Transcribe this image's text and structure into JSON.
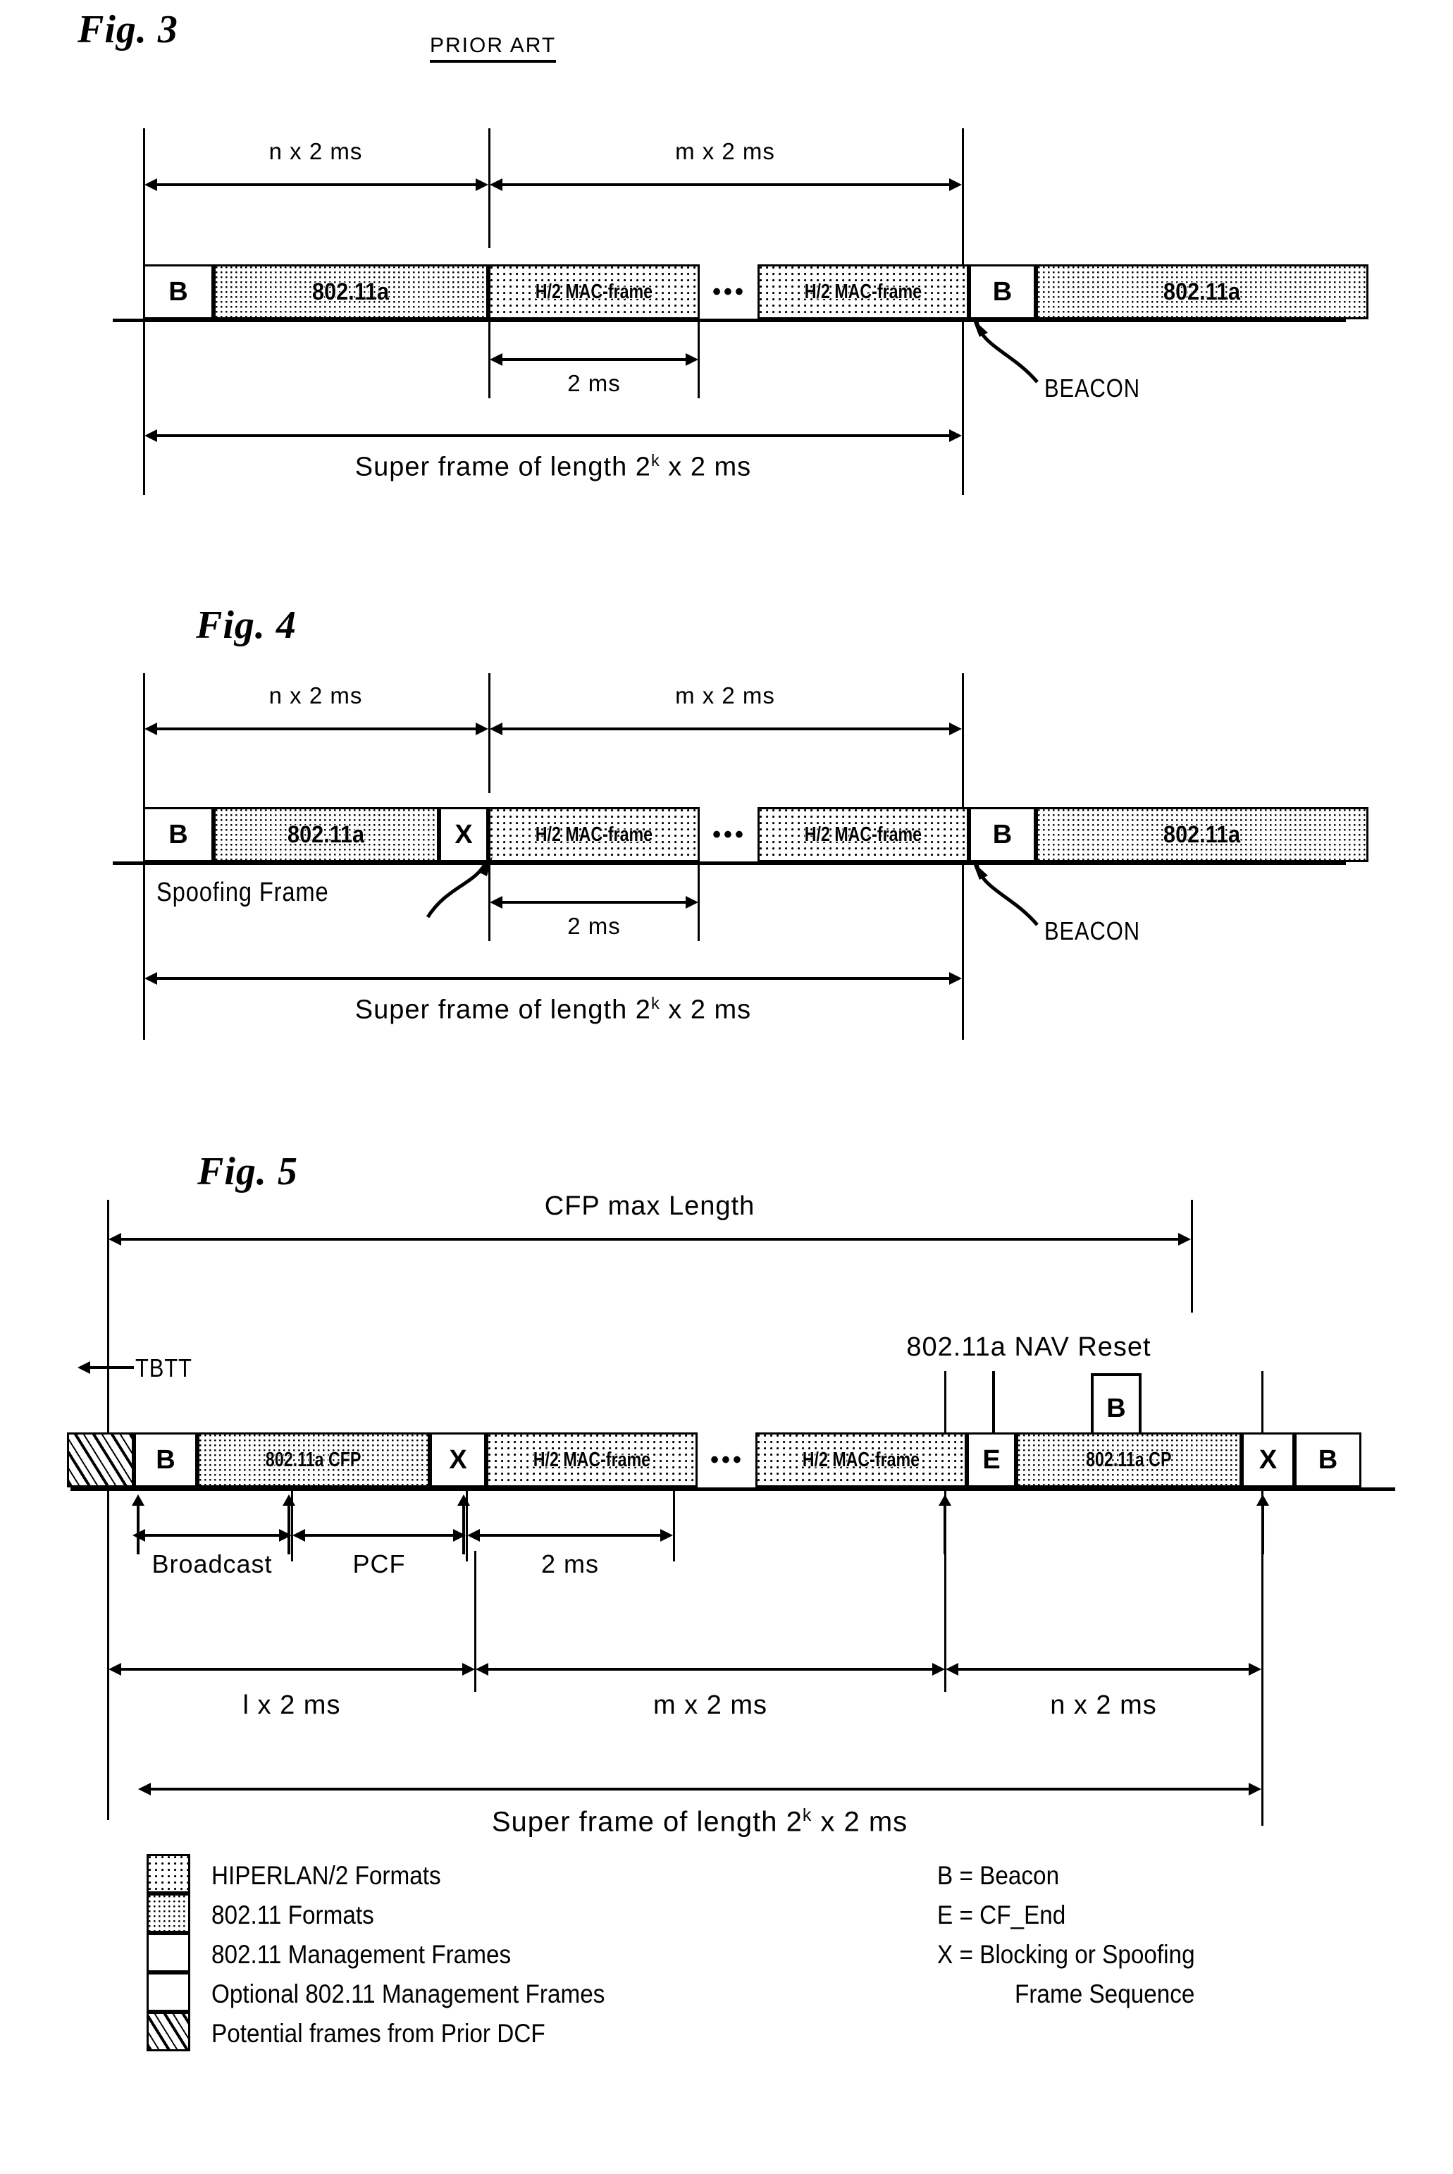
{
  "figures": [
    {
      "id": "fig3",
      "title": "Fig. 3",
      "note": "PRIOR ART",
      "top_dims": [
        {
          "label": "n x 2 ms"
        },
        {
          "label": "m x 2 ms"
        }
      ],
      "blocks": [
        {
          "label": "B",
          "kind": "mgmt"
        },
        {
          "label": "802.11a",
          "kind": "fmt80211"
        },
        {
          "label": "H/2 MAC-frame",
          "kind": "hiperlan2"
        },
        {
          "label": "•••",
          "kind": "ellipsis"
        },
        {
          "label": "H/2 MAC-frame",
          "kind": "hiperlan2"
        },
        {
          "label": "B",
          "kind": "mgmt"
        },
        {
          "label": "802.11a",
          "kind": "fmt80211"
        }
      ],
      "slot_label": "2 ms",
      "callout": "BEACON",
      "superframe_label": "Super frame of length 2",
      "superframe_exp": "k",
      "superframe_tail": " x 2 ms"
    },
    {
      "id": "fig4",
      "title": "Fig. 4",
      "top_dims": [
        {
          "label": "n x 2 ms"
        },
        {
          "label": "m x 2 ms"
        }
      ],
      "blocks": [
        {
          "label": "B",
          "kind": "mgmt"
        },
        {
          "label": "802.11a",
          "kind": "fmt80211"
        },
        {
          "label": "X",
          "kind": "mgmt"
        },
        {
          "label": "H/2 MAC-frame",
          "kind": "hiperlan2"
        },
        {
          "label": "•••",
          "kind": "ellipsis"
        },
        {
          "label": "H/2 MAC-frame",
          "kind": "hiperlan2"
        },
        {
          "label": "B",
          "kind": "mgmt"
        },
        {
          "label": "802.11a",
          "kind": "fmt80211"
        }
      ],
      "spoofing_label": "Spoofing Frame",
      "slot_label": "2 ms",
      "callout": "BEACON",
      "superframe_label": "Super frame of length 2",
      "superframe_exp": "k",
      "superframe_tail": " x 2 ms"
    },
    {
      "id": "fig5",
      "title": "Fig. 5",
      "cfp_label": "CFP max Length",
      "tbtt_label": "TBTT",
      "nav_label": "802.11a NAV Reset",
      "nav_box_label": "B",
      "blocks": [
        {
          "label": "",
          "kind": "priordcf"
        },
        {
          "label": "B",
          "kind": "mgmt"
        },
        {
          "label": "802.11a CFP",
          "kind": "fmt80211"
        },
        {
          "label": "X",
          "kind": "mgmt"
        },
        {
          "label": "H/2 MAC-frame",
          "kind": "hiperlan2"
        },
        {
          "label": "•••",
          "kind": "ellipsis"
        },
        {
          "label": "H/2 MAC-frame",
          "kind": "hiperlan2"
        },
        {
          "label": "E",
          "kind": "mgmt"
        },
        {
          "label": "802.11a CP",
          "kind": "fmt80211"
        },
        {
          "label": "X",
          "kind": "mgmt"
        },
        {
          "label": "B",
          "kind": "optmgmt"
        }
      ],
      "mid_labels": [
        "Broadcast",
        "PCF",
        "2 ms"
      ],
      "bottom_dims": [
        {
          "label": "l x 2 ms"
        },
        {
          "label": "m x 2 ms"
        },
        {
          "label": "n x 2 ms"
        }
      ],
      "superframe_label": "Super frame of length 2",
      "superframe_exp": "k",
      "superframe_tail": " x 2 ms"
    }
  ],
  "legend": {
    "patterns": [
      {
        "swatch": "hiperlan2",
        "label": "HIPERLAN/2 Formats"
      },
      {
        "swatch": "fmt80211",
        "label": "802.11 Formats"
      },
      {
        "swatch": "mgmt",
        "label": "802.11 Management Frames"
      },
      {
        "swatch": "optmgmt",
        "label": "Optional 802.11 Management Frames"
      },
      {
        "swatch": "priordcf",
        "label": "Potential frames from Prior DCF"
      }
    ],
    "abbreviations": [
      "B = Beacon",
      "E = CF_End",
      "X = Blocking or Spoofing",
      "Frame Sequence"
    ]
  }
}
